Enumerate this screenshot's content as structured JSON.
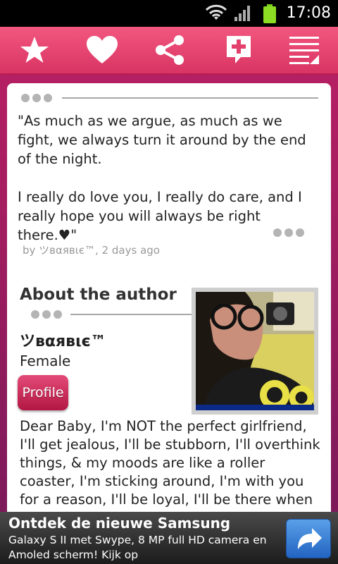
{
  "status": {
    "time": "17:08"
  },
  "toolbar": {
    "buttons": [
      "favorite",
      "like",
      "share",
      "add-quote",
      "menu"
    ]
  },
  "quote": {
    "text": "\"As much as we argue, as much as we fight, we always turn it around by the end of the night.\n\nI really do love you, I really do care, and I really hope you will always be right there.♥\"",
    "byline": "by ツвαявιє™, 2 days ago"
  },
  "author": {
    "section_title": "About the author",
    "name": "ツвαявιє™",
    "gender": "Female",
    "profile_label": "Profile",
    "bio": "Dear Baby, I'm NOT the perfect girlfriend, I'll get jealous, I'll be stubborn, I'll overthink things, & my moods are like a roller coaster, I'm sticking around, I'm with you for a reason, I'll be loyal, I'll be there when you need me, &"
  },
  "ad": {
    "title": "Ontdek de nieuwe Samsung",
    "text": "Galaxy S II met Swype, 8 MP full HD camera en Amoled scherm! Kijk op"
  },
  "colors": {
    "toolbar": "#e4426f",
    "background": "#a01e5e",
    "accent": "#d11e55"
  }
}
